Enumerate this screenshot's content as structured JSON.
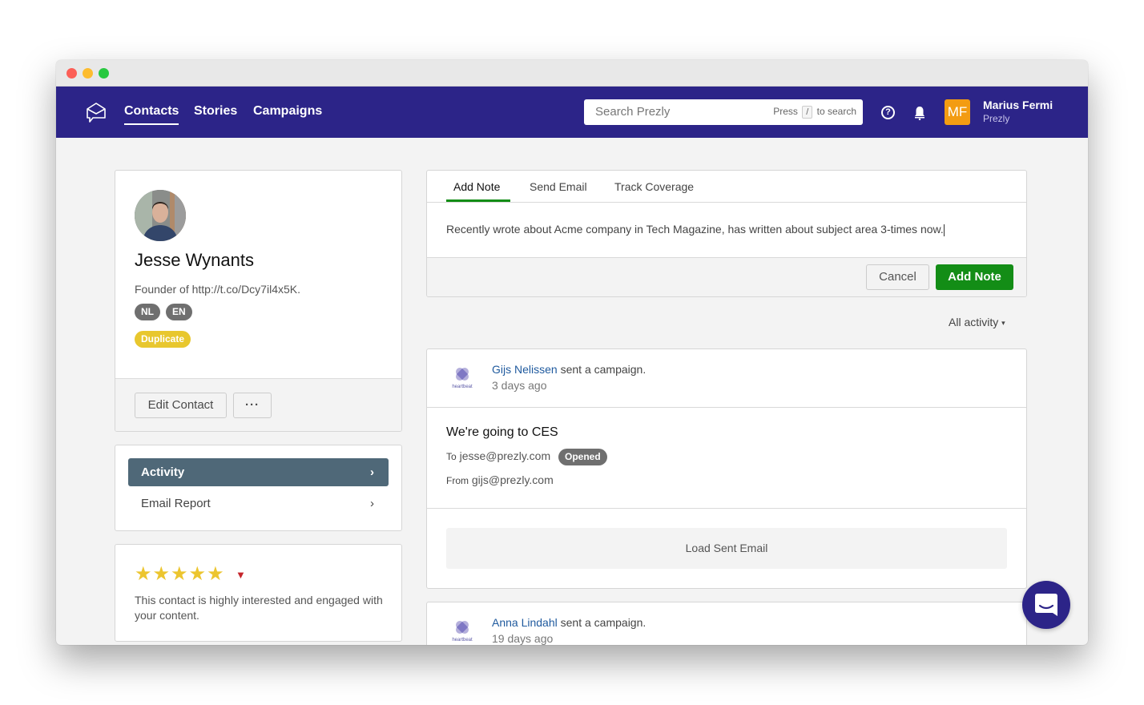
{
  "window": {
    "traffic_lights": [
      "close",
      "minimize",
      "maximize"
    ]
  },
  "navbar": {
    "logo_icon": "envelope-chat-icon",
    "links": [
      {
        "label": "Contacts",
        "active": true
      },
      {
        "label": "Stories",
        "active": false
      },
      {
        "label": "Campaigns",
        "active": false
      }
    ],
    "search": {
      "placeholder": "Search Prezly",
      "value": "",
      "hint_prefix": "Press",
      "hint_key": "/",
      "hint_suffix": "to search"
    },
    "help_icon": "?",
    "bell_icon": "bell-icon",
    "user": {
      "initials": "MF",
      "name": "Marius Fermi",
      "org": "Prezly",
      "avatar_color": "#f39c12"
    }
  },
  "profile": {
    "name": "Jesse Wynants",
    "title": "Founder of http://t.co/Dcy7il4x5K.",
    "languages": [
      "NL",
      "EN"
    ],
    "badge": "Duplicate",
    "badge_color": "#e8c72e",
    "edit_label": "Edit Contact",
    "more_label": "···"
  },
  "side_menu": {
    "items": [
      {
        "label": "Activity",
        "active": true,
        "chevron": "›"
      },
      {
        "label": "Email Report",
        "active": false,
        "chevron": "›"
      }
    ]
  },
  "rating": {
    "stars": 5,
    "max": 5,
    "stars_text": "★★★★★",
    "caret": "▼",
    "description": "This contact is highly interested and engaged with your content."
  },
  "note": {
    "tabs": [
      {
        "label": "Add Note",
        "active": true
      },
      {
        "label": "Send Email",
        "active": false
      },
      {
        "label": "Track Coverage",
        "active": false
      }
    ],
    "text": "Recently wrote about Acme company in Tech Magazine, has written about subject area 3-times now.",
    "cancel_label": "Cancel",
    "submit_label": "Add Note",
    "accent": "#138d16"
  },
  "activity_filter": {
    "label": "All activity",
    "caret": "▾"
  },
  "activities": [
    {
      "logo_label": "heartbeat",
      "actor": "Gijs Nelissen",
      "action": "sent a campaign.",
      "when": "3 days ago",
      "subject": "We're going to CES",
      "to_label": "To",
      "to": "jesse@prezly.com",
      "status": "Opened",
      "from_label": "From",
      "from": "gijs@prezly.com",
      "load_label": "Load Sent Email"
    },
    {
      "logo_label": "heartbeat",
      "actor": "Anna Lindahl",
      "action": "sent a campaign.",
      "when": "19 days ago"
    }
  ],
  "chat_widget": {
    "icon": "chat-bubble-icon",
    "color": "#2c2488"
  }
}
